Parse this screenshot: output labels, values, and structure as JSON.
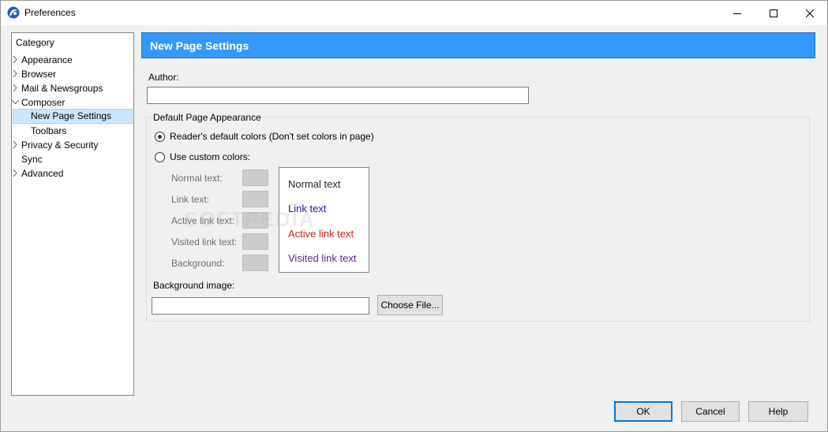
{
  "window": {
    "title": "Preferences",
    "icon": "app-logo-icon"
  },
  "tree": {
    "header": "Category",
    "items": [
      {
        "label": "Appearance",
        "expander": "collapsed"
      },
      {
        "label": "Browser",
        "expander": "collapsed"
      },
      {
        "label": "Mail & Newsgroups",
        "expander": "collapsed"
      },
      {
        "label": "Composer",
        "expander": "expanded"
      },
      {
        "label": "New Page Settings",
        "expander": "none",
        "selected": true
      },
      {
        "label": "Toolbars",
        "expander": "none"
      },
      {
        "label": "Privacy & Security",
        "expander": "collapsed"
      },
      {
        "label": "Sync",
        "expander": "none"
      },
      {
        "label": "Advanced",
        "expander": "collapsed"
      }
    ]
  },
  "panel": {
    "title": "New Page Settings",
    "author_label": "Author:",
    "author_value": "",
    "group_title": "Default Page Appearance",
    "radio_default": "Reader's default colors (Don't set colors in page)",
    "radio_custom": "Use custom colors:",
    "color_labels": {
      "normal": "Normal text:",
      "link": "Link text:",
      "active": "Active link text:",
      "visited": "Visited link text:",
      "background": "Background:"
    },
    "preview": {
      "normal": "Normal text",
      "link": "Link text",
      "active": "Active link text",
      "visited": "Visited link text"
    },
    "bg_image_label": "Background image:",
    "bg_image_value": "",
    "choose_file": "Choose File...",
    "watermark": "SOFTPEDIA"
  },
  "buttons": {
    "ok": "OK",
    "cancel": "Cancel",
    "help": "Help"
  },
  "colors": {
    "header_bg": "#3399ff",
    "link": "#1a1aa6",
    "active": "#cc1f1f",
    "visited": "#5e2592",
    "swatch": "#cccccc",
    "selection": "#cce8ff"
  }
}
